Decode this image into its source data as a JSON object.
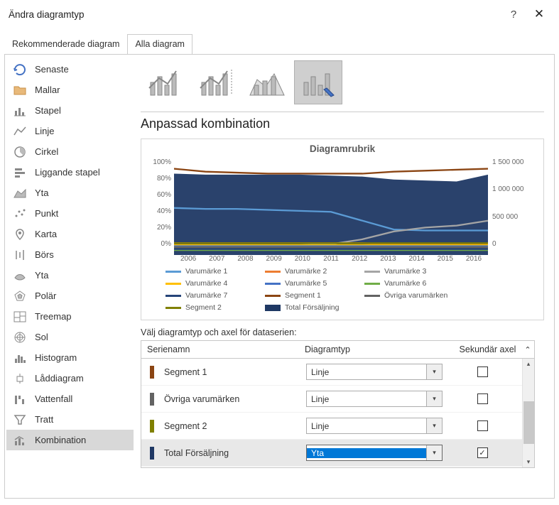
{
  "title": "Ändra diagramtyp",
  "tabs": {
    "recommended": "Rekommenderade diagram",
    "all": "Alla diagram"
  },
  "sidebar": [
    {
      "label": "Senaste",
      "icon": "recent"
    },
    {
      "label": "Mallar",
      "icon": "folder"
    },
    {
      "label": "Stapel",
      "icon": "bar"
    },
    {
      "label": "Linje",
      "icon": "line"
    },
    {
      "label": "Cirkel",
      "icon": "pie"
    },
    {
      "label": "Liggande stapel",
      "icon": "hbar"
    },
    {
      "label": "Yta",
      "icon": "area"
    },
    {
      "label": "Punkt",
      "icon": "scatter"
    },
    {
      "label": "Karta",
      "icon": "map"
    },
    {
      "label": "Börs",
      "icon": "stock"
    },
    {
      "label": "Yta",
      "icon": "surface"
    },
    {
      "label": "Polär",
      "icon": "radar"
    },
    {
      "label": "Treemap",
      "icon": "treemap"
    },
    {
      "label": "Sol",
      "icon": "sunburst"
    },
    {
      "label": "Histogram",
      "icon": "histogram"
    },
    {
      "label": "Låddiagram",
      "icon": "box"
    },
    {
      "label": "Vattenfall",
      "icon": "waterfall"
    },
    {
      "label": "Tratt",
      "icon": "funnel"
    },
    {
      "label": "Kombination",
      "icon": "combo",
      "selected": true
    }
  ],
  "section_heading": "Anpassad kombination",
  "chart_data": {
    "type": "line",
    "title": "Diagramrubrik",
    "y_left_ticks": [
      "100%",
      "80%",
      "60%",
      "40%",
      "20%",
      "0%"
    ],
    "y_right_ticks": [
      "1 500 000",
      "1 000 000",
      "500 000",
      "0"
    ],
    "x": [
      "2006",
      "2007",
      "2008",
      "2009",
      "2010",
      "2011",
      "2012",
      "2013",
      "2014",
      "2015",
      "2016"
    ],
    "series": [
      {
        "name": "Varumärke 1",
        "color": "#5b9bd5",
        "values": [
          48,
          47,
          47,
          46,
          45,
          44,
          35,
          26,
          25,
          25,
          25
        ]
      },
      {
        "name": "Varumärke 2",
        "color": "#ed7d31",
        "values": [
          12,
          12,
          12,
          12,
          12,
          12,
          12,
          11,
          11,
          11,
          11
        ]
      },
      {
        "name": "Varumärke 3",
        "color": "#a5a5a5",
        "values": [
          10,
          10,
          10,
          10,
          10,
          11,
          16,
          24,
          28,
          30,
          35
        ]
      },
      {
        "name": "Varumärke 4",
        "color": "#ffc000",
        "values": [
          10,
          10,
          10,
          10,
          10,
          10,
          10,
          10,
          10,
          10,
          10
        ]
      },
      {
        "name": "Varumärke 5",
        "color": "#4472c4",
        "values": [
          9,
          9,
          9,
          9,
          9,
          9,
          9,
          9,
          9,
          9,
          9
        ]
      },
      {
        "name": "Varumärke 6",
        "color": "#70ad47",
        "values": [
          5,
          5,
          5,
          5,
          5,
          5,
          5,
          5,
          5,
          5,
          5
        ]
      },
      {
        "name": "Varumärke 7",
        "color": "#264478",
        "values": [
          6,
          6,
          6,
          6,
          6,
          6,
          6,
          6,
          6,
          6,
          6
        ]
      },
      {
        "name": "Segment 1",
        "color": "#8b4513",
        "values": [
          88,
          85,
          84,
          83,
          83,
          83,
          83,
          85,
          86,
          87,
          88
        ]
      },
      {
        "name": "Övriga varumärken",
        "color": "#636363",
        "values": [
          8,
          8,
          8,
          8,
          8,
          8,
          8,
          8,
          8,
          8,
          8
        ]
      },
      {
        "name": "Segment 2",
        "color": "#808000",
        "values": [
          12,
          12,
          12,
          12,
          12,
          12,
          12,
          12,
          12,
          12,
          12
        ]
      },
      {
        "name": "Total Försäljning",
        "color": "#1f3864",
        "type": "area",
        "values": [
          83,
          82,
          82,
          82,
          82,
          81,
          80,
          77,
          76,
          75,
          82
        ]
      }
    ]
  },
  "series_config_label": "Välj diagramtyp och axel för dataserien:",
  "columns": {
    "c1": "Serienamn",
    "c2": "Diagramtyp",
    "c3": "Sekundär axel"
  },
  "rows": [
    {
      "name": "Segment 1",
      "swatch": "#8b4513",
      "type": "Linje",
      "secondary": false
    },
    {
      "name": "Övriga varumärken",
      "swatch": "#636363",
      "type": "Linje",
      "secondary": false
    },
    {
      "name": "Segment 2",
      "swatch": "#808000",
      "type": "Linje",
      "secondary": false
    },
    {
      "name": "Total Försäljning",
      "swatch": "#1f3864",
      "type": "Yta",
      "secondary": true,
      "highlight": true,
      "selected": true
    }
  ]
}
